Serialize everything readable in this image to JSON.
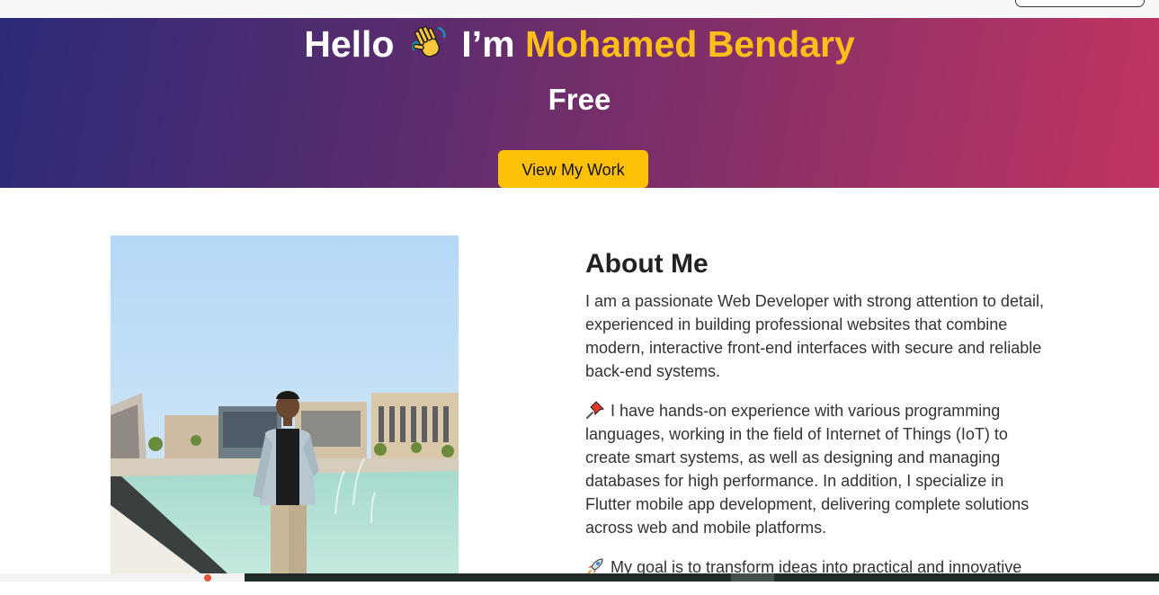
{
  "hero": {
    "greeting": "Hello",
    "wave_icon": "waving-hand-icon",
    "intro": "I’m",
    "name": "Mohamed Bendary",
    "subtitle": "Free",
    "cta_label": "View My Work",
    "colors": {
      "accent": "#ffbf1a",
      "button": "#ffc107",
      "gradient_start": "#2b2a78",
      "gradient_end": "#c23461"
    }
  },
  "about": {
    "title": "About Me",
    "paragraph1": "I am a passionate Web Developer with strong attention to detail, experienced in building professional websites that combine modern, interactive front-end interfaces with secure and reliable back-end systems.",
    "pin_icon": "pushpin-icon",
    "paragraph2": "I have hands-on experience with various programming languages, working in the field of Internet of Things (IoT) to create smart systems, as well as designing and managing databases for high performance. In addition, I specialize in Flutter mobile app development, delivering complete solutions across web and mobile platforms.",
    "rocket_icon": "rocket-icon",
    "paragraph3": "My goal is to transform ideas into practical and innovative"
  },
  "profile_photo": "profile-photo"
}
